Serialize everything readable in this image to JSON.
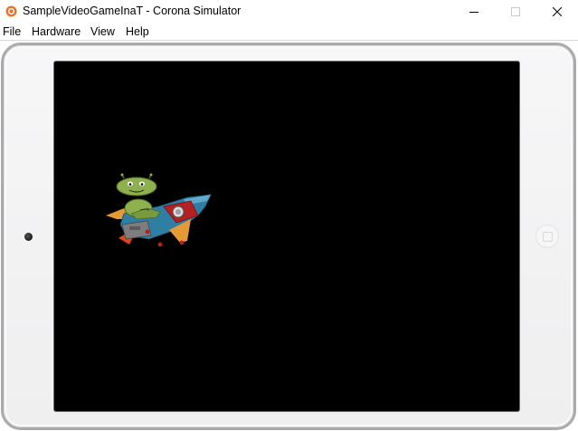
{
  "window": {
    "title": "SampleVideoGameInaT - Corona Simulator",
    "app_icon": "corona-simulator-icon",
    "controls": {
      "minimize_icon": "minimize-icon",
      "maximize_icon": "maximize-icon",
      "close_icon": "close-icon"
    }
  },
  "menubar": {
    "items": [
      {
        "label": "File"
      },
      {
        "label": "Hardware"
      },
      {
        "label": "View"
      },
      {
        "label": "Help"
      }
    ]
  },
  "device": {
    "type": "tablet-landscape",
    "frame_color": "#f3f3f4",
    "screen_color": "#000000",
    "camera_icon": "camera-icon",
    "home_button_icon": "home-button-icon"
  },
  "game": {
    "sprite": "alien-riding-rocket",
    "colors": {
      "alien": "#8fb04e",
      "rocket_body": "#2f7fa5",
      "rocket_nose": "#2f7fa5",
      "rocket_panel": "#b32122",
      "rocket_fins": "#e59a37",
      "exhaust": "#d9471f"
    }
  }
}
